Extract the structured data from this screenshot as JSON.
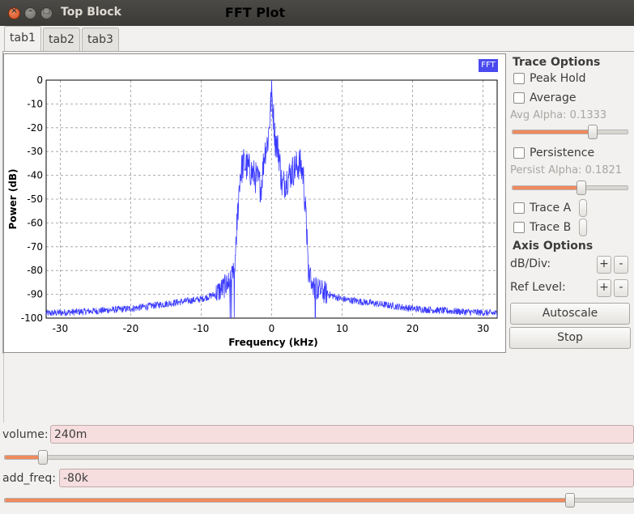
{
  "window": {
    "title": "Top Block"
  },
  "tabs": [
    {
      "label": "tab1"
    },
    {
      "label": "tab2"
    },
    {
      "label": "tab3"
    }
  ],
  "plot": {
    "title": "FFT Plot",
    "legend": "FFT",
    "series_color": "#3b3bff",
    "xlabel": "Frequency (kHz)",
    "ylabel": "Power (dB)",
    "xticks": [
      "-30",
      "-20",
      "-10",
      "0",
      "10",
      "20",
      "30"
    ],
    "yticks": [
      "0",
      "-10",
      "-20",
      "-30",
      "-40",
      "-50",
      "-60",
      "-70",
      "-80",
      "-90",
      "-100"
    ]
  },
  "chart_data": {
    "type": "line",
    "title": "FFT Plot",
    "xlabel": "Frequency (kHz)",
    "ylabel": "Power (dB)",
    "xlim": [
      -32,
      32
    ],
    "ylim": [
      -100,
      0
    ],
    "grid": true,
    "legend_placement": "top-right",
    "series": [
      {
        "name": "FFT",
        "x": [
          -32,
          -25,
          -20,
          -15,
          -10,
          -8,
          -6,
          -5.2,
          -5,
          -4.5,
          -4,
          -3,
          -2,
          -1.5,
          -1,
          -0.5,
          0,
          0.5,
          1,
          1.5,
          2,
          3,
          4,
          4.5,
          5,
          5.2,
          6,
          8,
          10,
          15,
          20,
          25,
          32
        ],
        "y": [
          -98,
          -97,
          -96,
          -94,
          -92,
          -90,
          -85,
          -80,
          -65,
          -40,
          -35,
          -38,
          -42,
          -45,
          -30,
          -25,
          -5,
          -25,
          -30,
          -45,
          -42,
          -38,
          -35,
          -40,
          -65,
          -80,
          -87,
          -90,
          -92,
          -94,
          -96,
          -97,
          -98
        ]
      }
    ]
  },
  "trace_options": {
    "title": "Trace Options",
    "peak_hold": "Peak Hold",
    "average": "Average",
    "avg_alpha": "Avg Alpha: 0.1333",
    "avg_alpha_level": 0.7,
    "persistence": "Persistence",
    "persist_alpha": "Persist Alpha: 0.1821",
    "persist_alpha_level": 0.6,
    "trace_a": "Trace A",
    "trace_b": "Trace B"
  },
  "axis_options": {
    "title": "Axis Options",
    "db_div": "dB/Div:",
    "ref_level": "Ref Level:",
    "plus": "+",
    "minus": "-",
    "autoscale": "Autoscale",
    "stop": "Stop"
  },
  "controls": {
    "volume_label": "volume:",
    "volume_value": "240m",
    "volume_level": 0.06,
    "add_freq_label": "add_freq:",
    "add_freq_value": "-80k",
    "add_freq_level": 0.9
  }
}
